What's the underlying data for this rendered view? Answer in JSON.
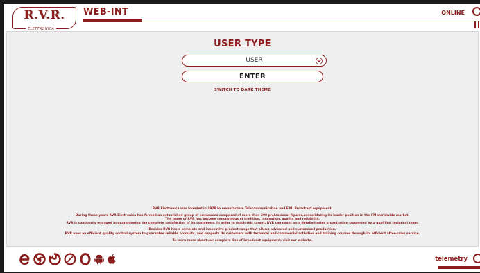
{
  "header": {
    "logo_text": "R.V.R.",
    "logo_subtext": "ELETTRONICA",
    "app_title": "WEB-INT",
    "status_label": "ONLINE"
  },
  "login": {
    "title": "USER TYPE",
    "user_type_selected": "USER",
    "enter_label": "ENTER",
    "theme_link": "SWITCH TO DARK THEME"
  },
  "about": {
    "line1": "RVR Elettronica was founded in 1979 to manufacture Telecommunication and F.M. Broadcast equipment.",
    "line2": "During these years RVR Elettronica has formed an established group of companies composed of more than 200 professional figures,consolidating its leader position in the FM worldwide market.",
    "line3": "The name of RVR has become synonymous of tradition, innovation, quality and reliability.",
    "line4": "RVR is constantly engaged in guaranteeing the complete satisfaction of its customers. In order to reach this target, RVR can count on a detailed sales organization supported by a qualified technical team.",
    "line5": "Besides RVR has a complete and innovative product range that allows advanced and customised production.",
    "line6": "RVR uses an efficient quality control system to guarantee reliable products, and supports its customers with technical and commercial activities and training courses through its efficient after-sales service.",
    "line7": "To learn more about our complete line of broadcast equipment, visit our website."
  },
  "footer": {
    "icons": [
      "edge-icon",
      "chrome-icon",
      "firefox-icon",
      "safari-icon",
      "opera-icon",
      "android-icon",
      "apple-icon"
    ],
    "telemetry_label": "telemetry"
  },
  "colors": {
    "accent": "#8a1c1c",
    "panel_background": "#efefef",
    "page_background": "#ffffff"
  }
}
